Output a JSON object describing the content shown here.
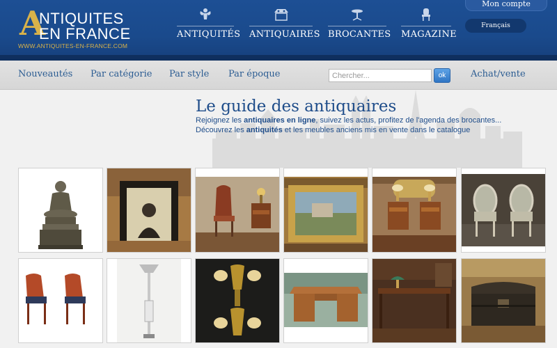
{
  "brand": {
    "logo_letter": "A",
    "logo_line1": "NTIQUITES",
    "logo_line2": "EN FRANCE",
    "url": "WWW.ANTIQUITES-EN-FRANCE.COM"
  },
  "main_nav": [
    {
      "label": "ANTIQUITÉS",
      "icon": "cherub-icon"
    },
    {
      "label": "ANTIQUAIRES",
      "icon": "store-icon"
    },
    {
      "label": "BROCANTES",
      "icon": "table-icon"
    },
    {
      "label": "MAGAZINE",
      "icon": "chair-icon"
    }
  ],
  "account": {
    "label": "Mon compte"
  },
  "language": {
    "label": "Français"
  },
  "sub_nav": {
    "links": [
      "Nouveautés",
      "Par catégorie",
      "Par style",
      "Par époque"
    ],
    "search_placeholder": "Chercher...",
    "ok_label": "ok",
    "right_link": "Achat/vente"
  },
  "hero": {
    "title": "Le guide des antiquaires",
    "line1_pre": "Rejoignez les ",
    "line1_bold": "antiquaires en ligne",
    "line1_post": ", suivez les actus, profitez de l'agenda des brocantes...",
    "line2_pre": "Découvrez les ",
    "line2_bold": "antiquités",
    "line2_post": " et les meubles anciens mis en vente dans le catalogue"
  },
  "gallery": [
    {
      "subject": "Buddha statue"
    },
    {
      "subject": "Framed portrait"
    },
    {
      "subject": "Chair and side table"
    },
    {
      "subject": "Framed landscape painting"
    },
    {
      "subject": "Pair of bedside tables with lamps"
    },
    {
      "subject": "Pair of medallion armchairs"
    },
    {
      "subject": "Pair of red armchairs"
    },
    {
      "subject": "Floor lamp"
    },
    {
      "subject": "Gilt bronze sconces"
    },
    {
      "subject": "Wooden desk"
    },
    {
      "subject": "Writing desk with lamp"
    },
    {
      "subject": "Wooden chest"
    }
  ]
}
